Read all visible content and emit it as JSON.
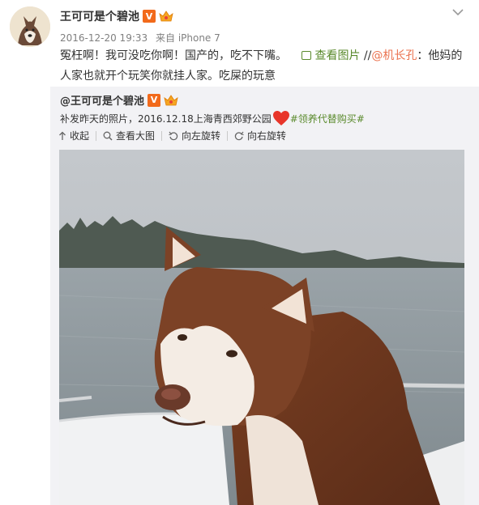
{
  "post": {
    "username": "王可可是个碧池",
    "verified_badge": "V",
    "timestamp": "2016-12-20 19:33",
    "source_prefix": "来自",
    "source_device": "iPhone 7",
    "text_line1_a": "冤枉啊！我可没吃你啊！国产的，吃不下嘴。",
    "view_picture": "查看图片",
    "repost_sep": "//",
    "mention": "@机长孔",
    "text_line1_b": "：他妈的",
    "text_line2": "人家也就开个玩笑你就挂人家。吃屎的玩意"
  },
  "repost": {
    "username": "@王可可是个碧池",
    "verified_badge": "V",
    "text": "补发昨天的照片，2016.12.18上海青西郊野公园",
    "hashtag": "#领养代替购买#",
    "actions": {
      "collapse": "收起",
      "view_large": "查看大图",
      "rotate_left": "向左旋转",
      "rotate_right": "向右旋转"
    }
  },
  "colors": {
    "link": "#eb7350",
    "tag_green": "#5a8a2c",
    "repost_bg": "#f2f2f5",
    "badge_orange": "#f26a1b"
  },
  "icons": [
    "chevron-down-icon",
    "verified-v-icon",
    "crown-badge-icon",
    "picture-icon",
    "heart-icon",
    "collapse-arrow-icon",
    "magnifier-icon",
    "rotate-left-icon",
    "rotate-right-icon"
  ]
}
